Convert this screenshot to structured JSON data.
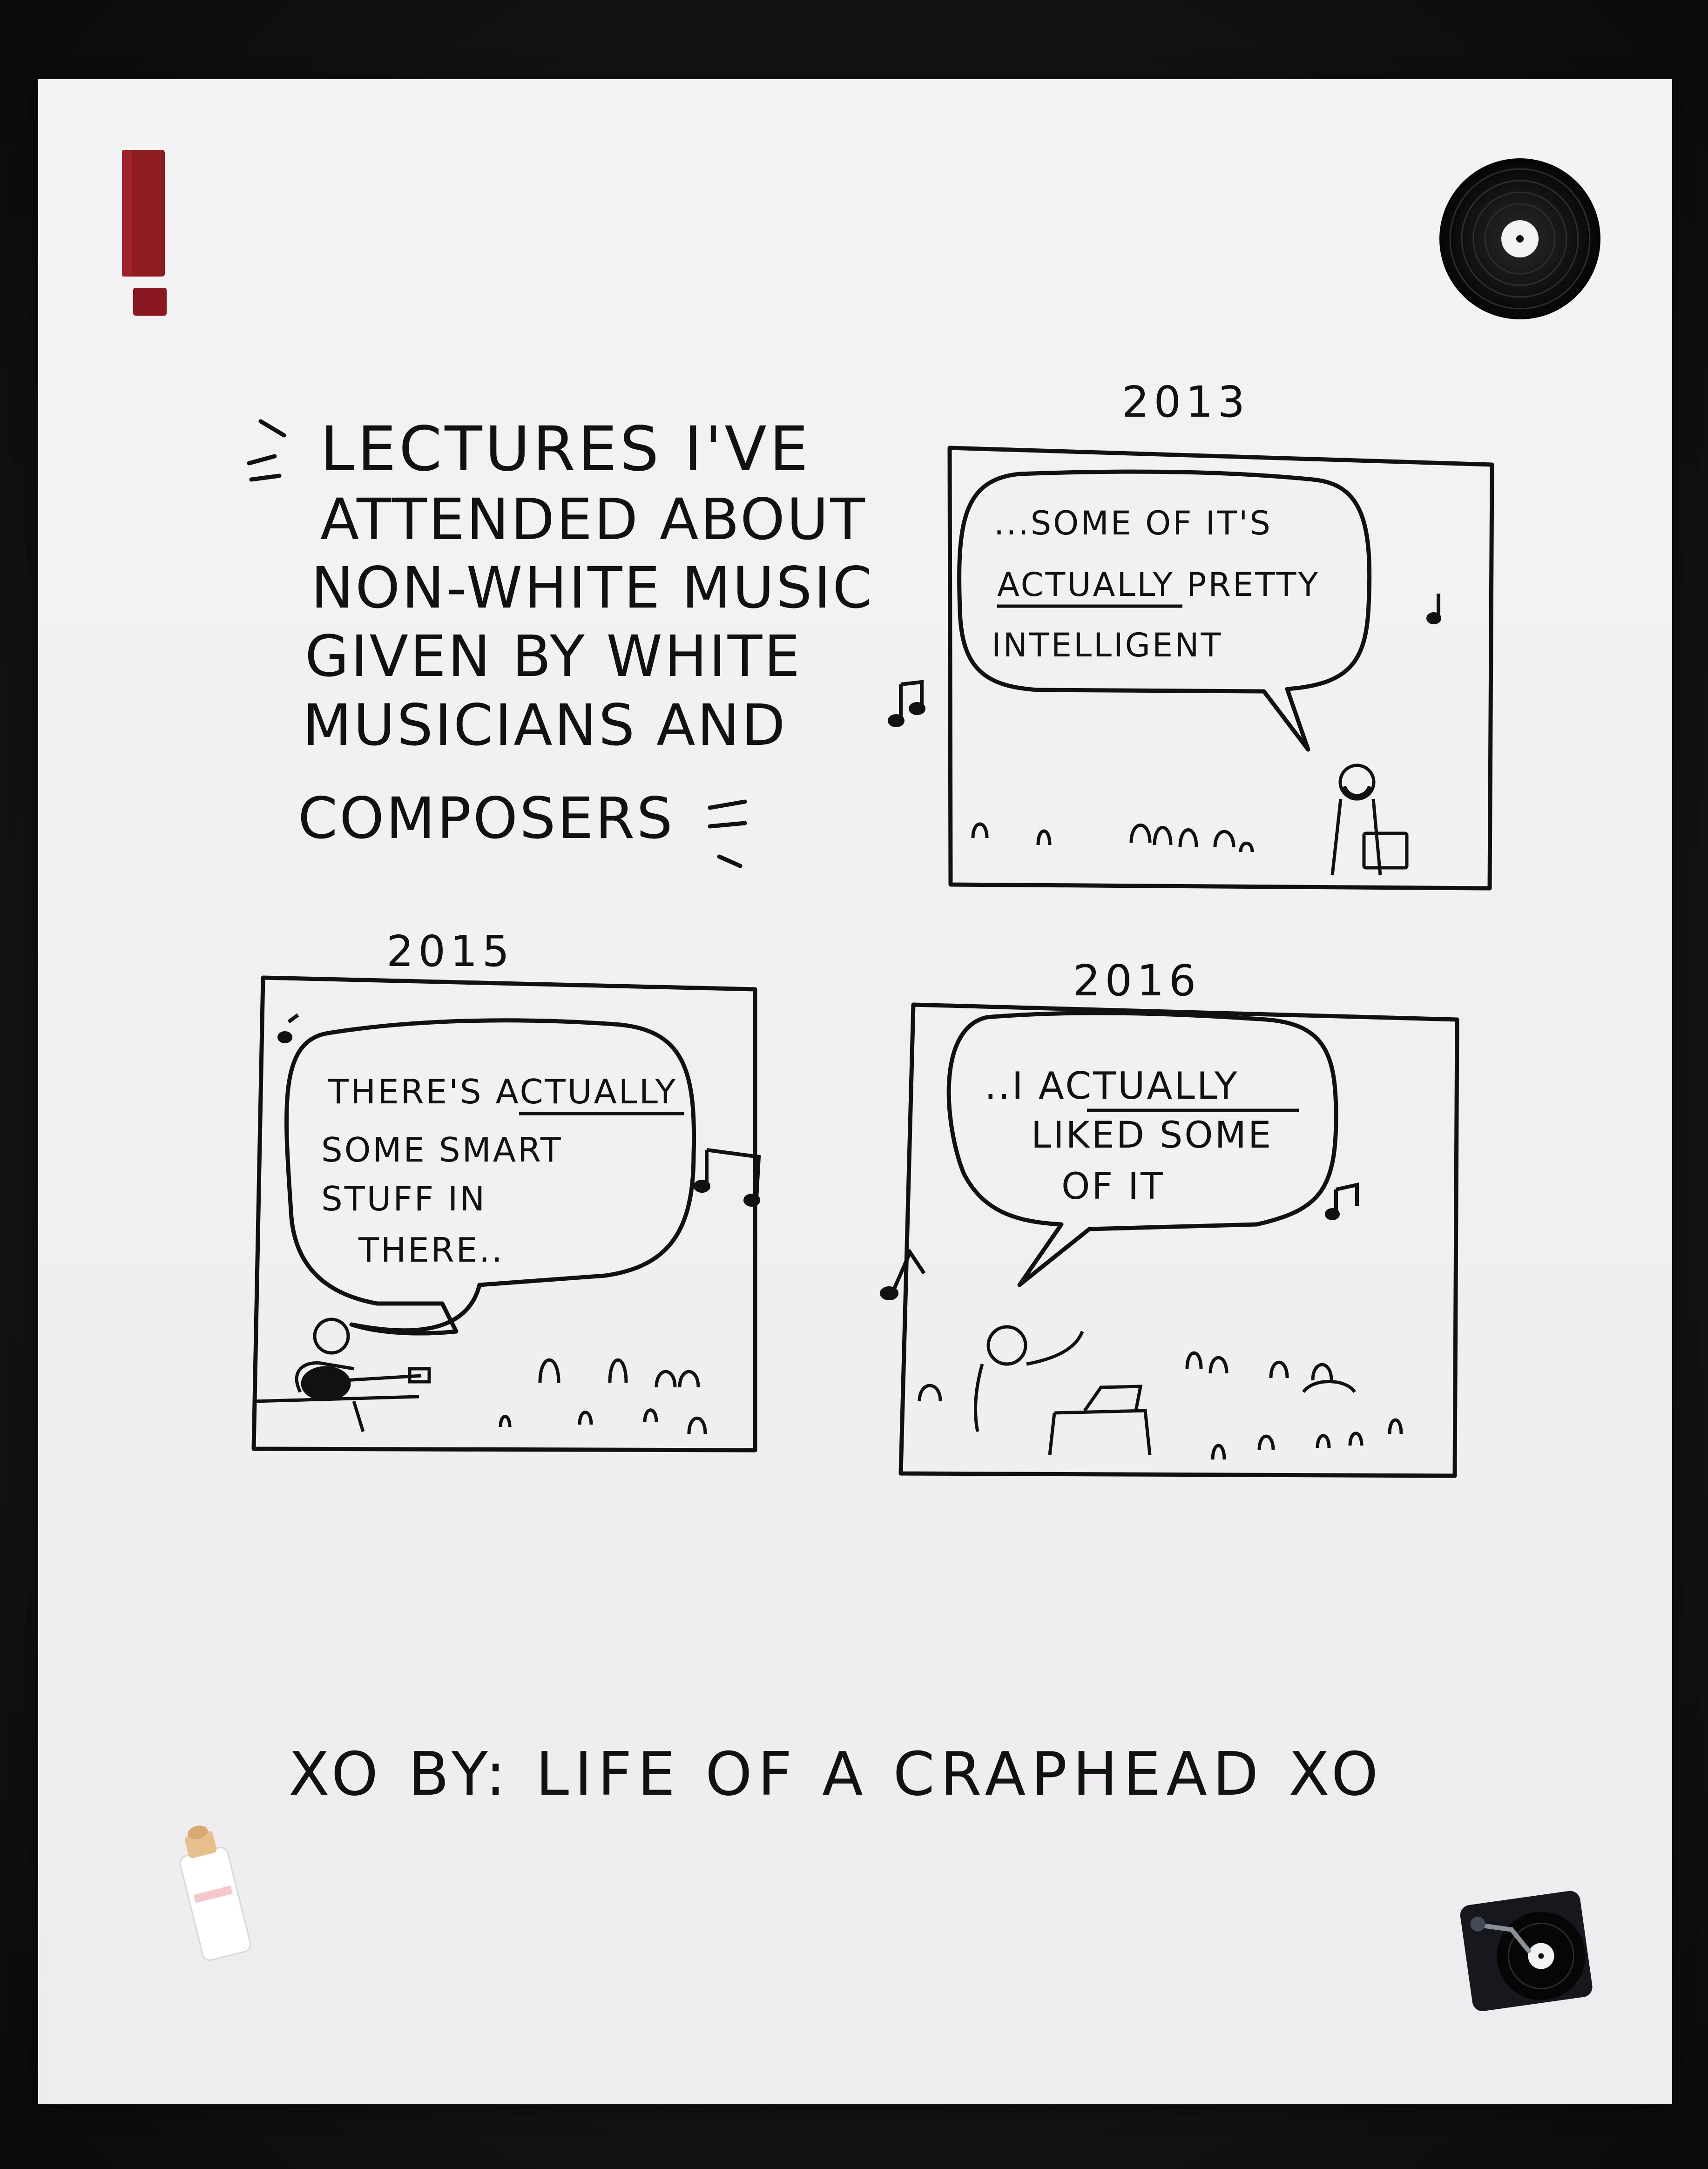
{
  "comic": {
    "title_lines": [
      "LECTURES I'VE",
      "ATTENDED ABOUT",
      "NON-WHITE MUSIC",
      "GIVEN BY WHITE",
      "MUSICIANS AND",
      "COMPOSERS"
    ],
    "panels": [
      {
        "year": "2013",
        "speech_lines": [
          "...SOME OF IT'S",
          "ACTUALLY PRETTY",
          "INTELLIGENT"
        ]
      },
      {
        "year": "2015",
        "speech_lines": [
          "THERE'S ACTUALLY",
          "SOME SMART",
          "STUFF IN",
          "THERE.."
        ]
      },
      {
        "year": "2016",
        "speech_lines": [
          "..I ACTUALLY",
          "LIKED SOME",
          "OF IT"
        ]
      }
    ],
    "signature": "XO BY: LIFE OF A CRAPHEAD XO"
  },
  "props": {
    "paper_color": "#f2f1f2",
    "background_color": "#141414",
    "exclamation_color": "#8e1a22",
    "ink_color": "#111111"
  }
}
